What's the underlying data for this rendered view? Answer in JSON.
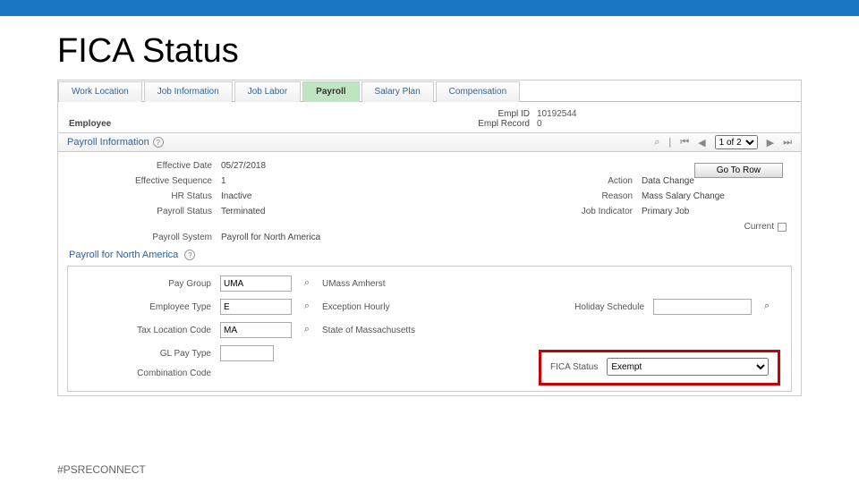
{
  "page_title": "FICA Status",
  "tabs": [
    "Work Location",
    "Job Information",
    "Job Labor",
    "Payroll",
    "Salary Plan",
    "Compensation"
  ],
  "active_tab": "Payroll",
  "employee_label": "Employee",
  "empl_id_label": "Empl ID",
  "empl_id": "10192544",
  "empl_record_label": "Empl Record",
  "empl_record": "0",
  "section_title": "Payroll Information",
  "pager_text": "1 of 2",
  "gotorow": "Go To Row",
  "effective_date_label": "Effective Date",
  "effective_date": "05/27/2018",
  "effective_sequence_label": "Effective Sequence",
  "effective_sequence": "1",
  "hr_status_label": "HR Status",
  "hr_status": "Inactive",
  "payroll_status_label": "Payroll Status",
  "payroll_status": "Terminated",
  "action_label": "Action",
  "action": "Data Change",
  "reason_label": "Reason",
  "reason": "Mass Salary Change",
  "job_indicator_label": "Job Indicator",
  "job_indicator": "Primary Job",
  "current_label": "Current",
  "payroll_system_label": "Payroll System",
  "payroll_system": "Payroll for North America",
  "pna_title": "Payroll for North America",
  "pay_group_label": "Pay Group",
  "pay_group": "UMA",
  "pay_group_desc": "UMass Amherst",
  "employee_type_label": "Employee Type",
  "employee_type": "E",
  "employee_type_desc": "Exception Hourly",
  "tax_location_label": "Tax Location Code",
  "tax_location": "MA",
  "tax_location_desc": "State of Massachusetts",
  "gl_paytype_label": "GL Pay Type",
  "gl_paytype": "",
  "combination_label": "Combination Code",
  "holiday_label": "Holiday Schedule",
  "holiday": "",
  "fica_label": "FICA Status",
  "fica_value": "Exempt",
  "footer": "#PSRECONNECT"
}
